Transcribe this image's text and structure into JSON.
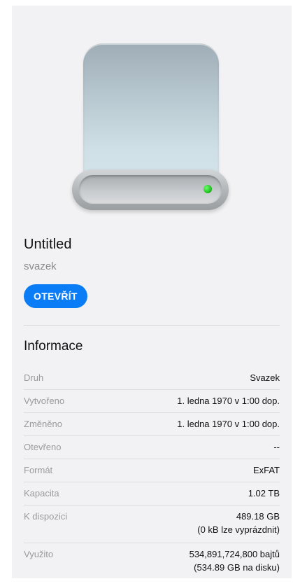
{
  "volume": {
    "name": "Untitled",
    "kind_label": "svazek",
    "open_button": "OTEVŘÍT"
  },
  "info": {
    "heading": "Informace",
    "rows": [
      {
        "label": "Druh",
        "value": "Svazek"
      },
      {
        "label": "Vytvořeno",
        "value": "1. ledna 1970 v 1:00 dop."
      },
      {
        "label": "Změněno",
        "value": "1. ledna 1970 v 1:00 dop."
      },
      {
        "label": "Otevřeno",
        "value": "--"
      },
      {
        "label": "Formát",
        "value": "ExFAT"
      },
      {
        "label": "Kapacita",
        "value": "1.02 TB"
      },
      {
        "label": "K dispozici",
        "value": "489.18 GB",
        "value2": "(0 kB lze vyprázdnit)"
      },
      {
        "label": "Využito",
        "value": "534,891,724,800 bajtů",
        "value2": "(534.89 GB na disku)"
      }
    ]
  },
  "colors": {
    "accent": "#0a7cf5",
    "led": "#22c322",
    "panel_bg": "#f2f2f4"
  },
  "icons": {
    "drive": "external-drive-icon",
    "status_led": "status-led-icon"
  }
}
